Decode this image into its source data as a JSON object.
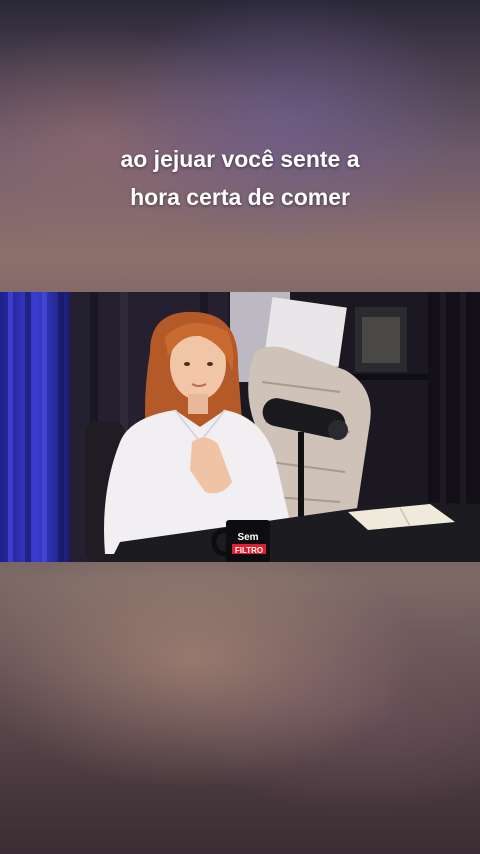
{
  "caption": {
    "line1": "ao jejuar você sente a",
    "line2": "hora certa de comer"
  },
  "scene": {
    "mug_text_top": "Sem",
    "mug_text_bottom": "FILTRO"
  },
  "colors": {
    "caption_text": "#ffffff",
    "curtain_blue": "#2b2fb0",
    "shirt": "#f1eff2",
    "hair": "#c0652e",
    "table": "#1b1b20"
  }
}
